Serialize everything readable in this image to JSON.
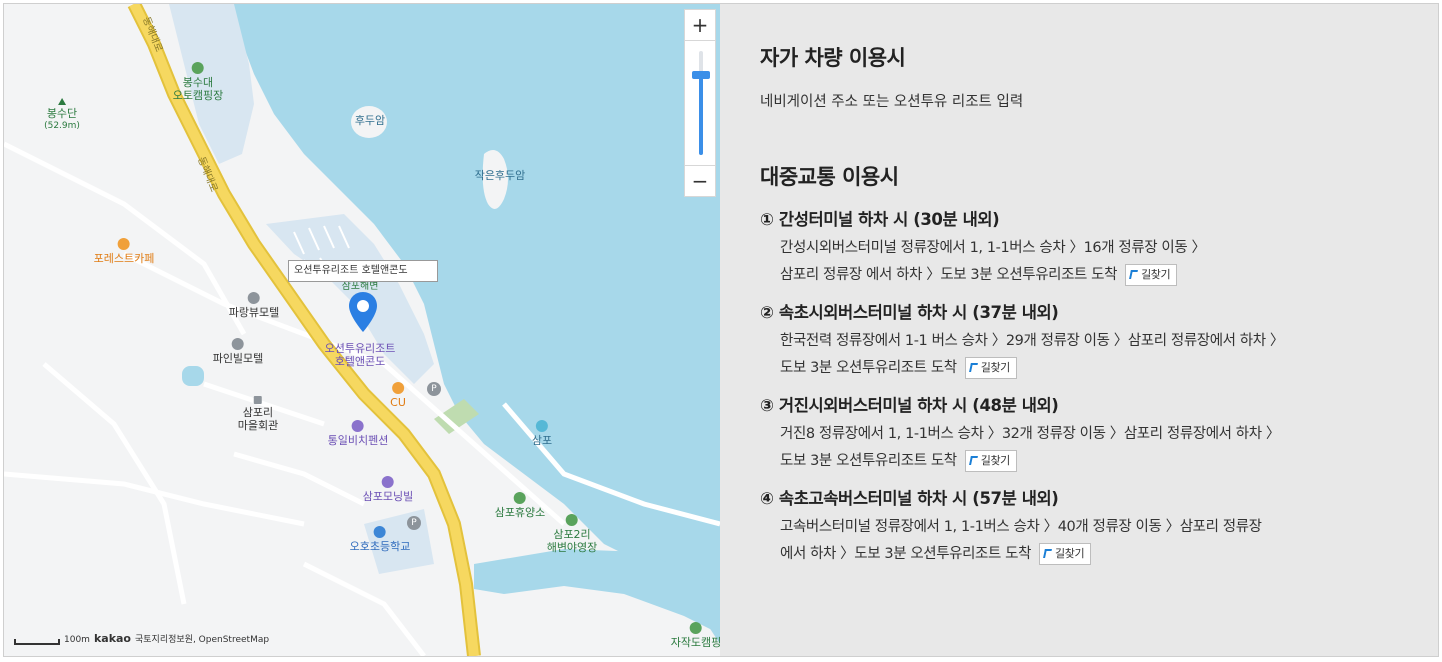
{
  "map": {
    "marker_label": "오션투유리조트 호텔앤콘도",
    "zoom_in": "+",
    "zoom_out": "−",
    "scale_label": "100m",
    "attribution_brand": "kakao",
    "attribution_text": "국토지리정보원, OpenStreetMap",
    "roads": [
      "동해대로",
      "동해대로"
    ],
    "pois": [
      {
        "name": "봉수대",
        "name2": "오토캠핑장",
        "type": "green"
      },
      {
        "name": "봉수단",
        "sub": "(52.9m)",
        "type": "green"
      },
      {
        "name": "후두암",
        "type": "sea"
      },
      {
        "name": "작은후두암",
        "type": "sea"
      },
      {
        "name": "포레스트카페",
        "type": "orange"
      },
      {
        "name": "파랑뷰모텔",
        "type": "grey"
      },
      {
        "name": "파인빌모텔",
        "type": "grey"
      },
      {
        "name": "삼포리",
        "name2": "마을회관",
        "type": "grey"
      },
      {
        "name": "오션투유리조트",
        "name2": "호텔앤콘도",
        "type": "purple"
      },
      {
        "name": "CU",
        "type": "orange"
      },
      {
        "name": "통일비치펜션",
        "type": "purple"
      },
      {
        "name": "삼포",
        "type": "sea"
      },
      {
        "name": "삼포모닝빌",
        "type": "purple"
      },
      {
        "name": "삼포휴양소",
        "type": "green"
      },
      {
        "name": "삼포2리",
        "name2": "해변야영장",
        "type": "green"
      },
      {
        "name": "오호초등학교",
        "type": "blue"
      },
      {
        "name": "자작도캠핑",
        "type": "green"
      },
      {
        "name": "삼포해변",
        "type": "green"
      }
    ]
  },
  "panel": {
    "car_title": "자가 차량 이용시",
    "car_desc": "네비게이션 주소 또는 오션투유 리조트 입력",
    "transit_title": "대중교통 이용시",
    "find_label": "길찾기",
    "routes": [
      {
        "title": "① 간성터미널 하차 시 (30분 내외)",
        "line1": "간성시외버스터미널 정류장에서 1, 1-1버스 승차 〉16개 정류장 이동 〉",
        "line2": "삼포리 정류장 에서 하차 〉도보 3분 오션투유리조트 도착"
      },
      {
        "title": "② 속초시외버스터미널 하차 시 (37분 내외)",
        "line1": "한국전력 정류장에서 1-1 버스 승차 〉29개 정류장 이동 〉삼포리 정류장에서 하차 〉",
        "line2": "도보 3분 오션투유리조트 도착"
      },
      {
        "title": "③ 거진시외버스터미널 하차 시 (48분 내외)",
        "line1": "거진8 정류장에서 1, 1-1버스 승차 〉32개 정류장 이동 〉삼포리 정류장에서 하차 〉",
        "line2": "도보 3분 오션투유리조트 도착"
      },
      {
        "title": "④ 속초고속버스터미널 하차 시 (57분 내외)",
        "line1": "고속버스터미널 정류장에서 1, 1-1버스 승차 〉40개 정류장 이동 〉삼포리 정류장",
        "line2": "에서 하차 〉도보 3분 오션투유리조트 도착"
      }
    ]
  },
  "colors": {
    "sea": "#a7d8ea",
    "road": "#f6d860",
    "panel_bg": "#e8e8e8",
    "accent": "#3b8fe8"
  }
}
